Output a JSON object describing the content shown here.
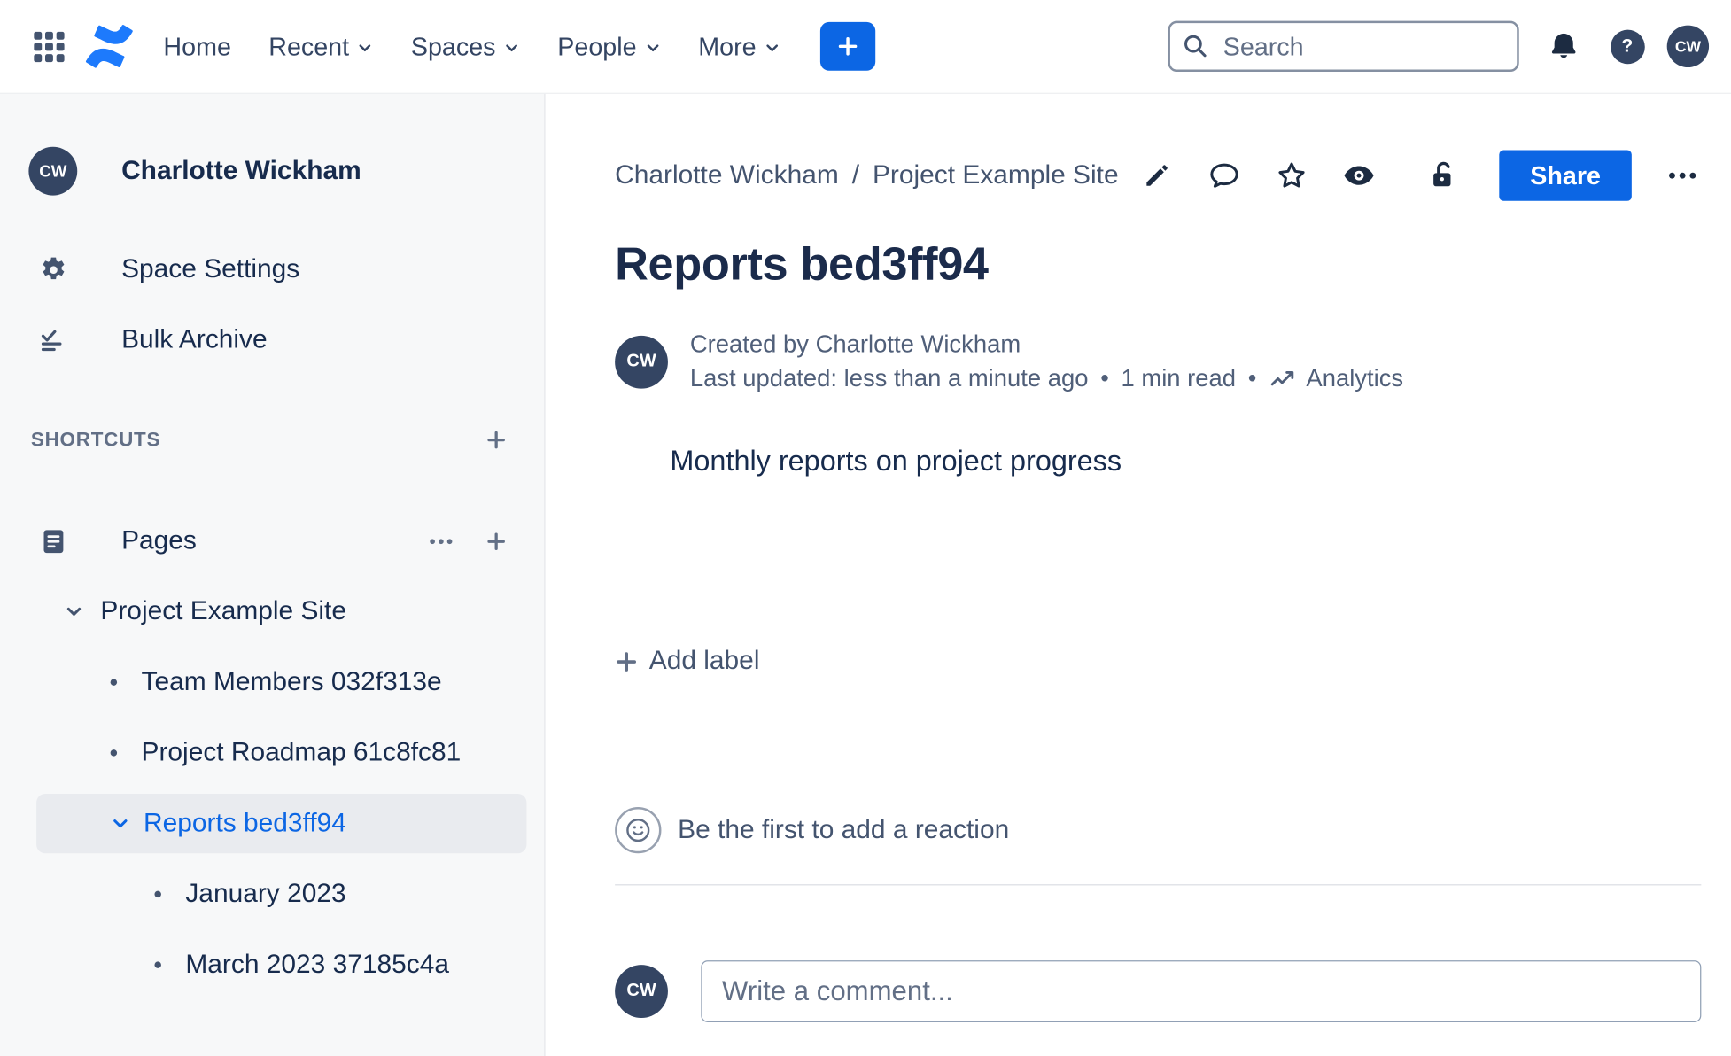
{
  "topbar": {
    "nav": [
      {
        "label": "Home",
        "chevron": false
      },
      {
        "label": "Recent",
        "chevron": true
      },
      {
        "label": "Spaces",
        "chevron": true
      },
      {
        "label": "People",
        "chevron": true
      },
      {
        "label": "More",
        "chevron": true
      }
    ],
    "search_placeholder": "Search",
    "help_glyph": "?",
    "avatar_initials": "CW"
  },
  "sidebar": {
    "user_name": "Charlotte Wickham",
    "avatar_initials": "CW",
    "menu": [
      {
        "label": "Space Settings"
      },
      {
        "label": "Bulk Archive"
      }
    ],
    "shortcuts_heading": "SHORTCUTS",
    "pages_label": "Pages",
    "tree": {
      "root_label": "Project Example Site",
      "items": [
        {
          "label": "Team Members 032f313e"
        },
        {
          "label": "Project Roadmap 61c8fc81"
        },
        {
          "label": "Reports bed3ff94",
          "selected": true
        }
      ],
      "sub_items": [
        {
          "label": "January 2023"
        },
        {
          "label": "March 2023 37185c4a"
        }
      ]
    }
  },
  "main": {
    "breadcrumb": {
      "parent": "Charlotte Wickham",
      "separator": "/",
      "current": "Project Example Site"
    },
    "share_label": "Share",
    "title": "Reports bed3ff94",
    "byline": {
      "avatar_initials": "CW",
      "created": "Created by Charlotte Wickham",
      "updated": "Last updated: less than a minute ago",
      "dot": "•",
      "read_time": "1 min read",
      "analytics_label": "Analytics"
    },
    "body_text": "Monthly reports on project progress",
    "add_label_text": "Add label",
    "reaction_prompt": "Be the first to add a reaction",
    "comment": {
      "avatar_initials": "CW",
      "placeholder": "Write a comment..."
    }
  },
  "colors": {
    "brand_blue": "#0C66E4",
    "logo_blue": "#1D7AFC",
    "navy_text": "#172B4D",
    "muted_text": "#626F86",
    "sidebar_bg": "#F7F8F9",
    "selected_bg": "#E9EBEF",
    "avatar_bg": "#344563"
  }
}
